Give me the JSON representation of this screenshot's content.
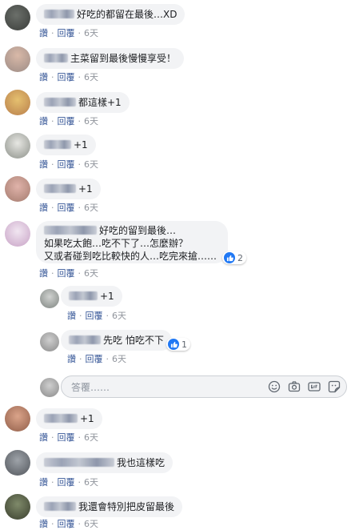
{
  "actions": {
    "like": "讚",
    "reply": "回覆",
    "time": "6天"
  },
  "reply_placeholder": "答覆……",
  "comments": [
    {
      "text": "好吃的都留在最後…XD"
    },
    {
      "text": "主菜留到最後慢慢享受！"
    },
    {
      "text": "都這樣+1"
    },
    {
      "text": "+1"
    },
    {
      "text": "+1"
    },
    {
      "line1": "好吃的留到最後…",
      "line2": "如果吃太飽…吃不下了…怎麼辦？",
      "line3": "又或者碰到吃比較快的人…吃完來搶……",
      "reactions": "2"
    },
    {
      "text": "+1"
    },
    {
      "text": "先吃 怕吃不下",
      "reactions": "1"
    },
    {
      "text": "+1"
    },
    {
      "text": "我也這樣吃"
    },
    {
      "text": "我還會特別把皮留最後"
    }
  ],
  "colors": {
    "link": "#385898",
    "bubble": "#f2f3f5",
    "like": "#2078f4"
  }
}
